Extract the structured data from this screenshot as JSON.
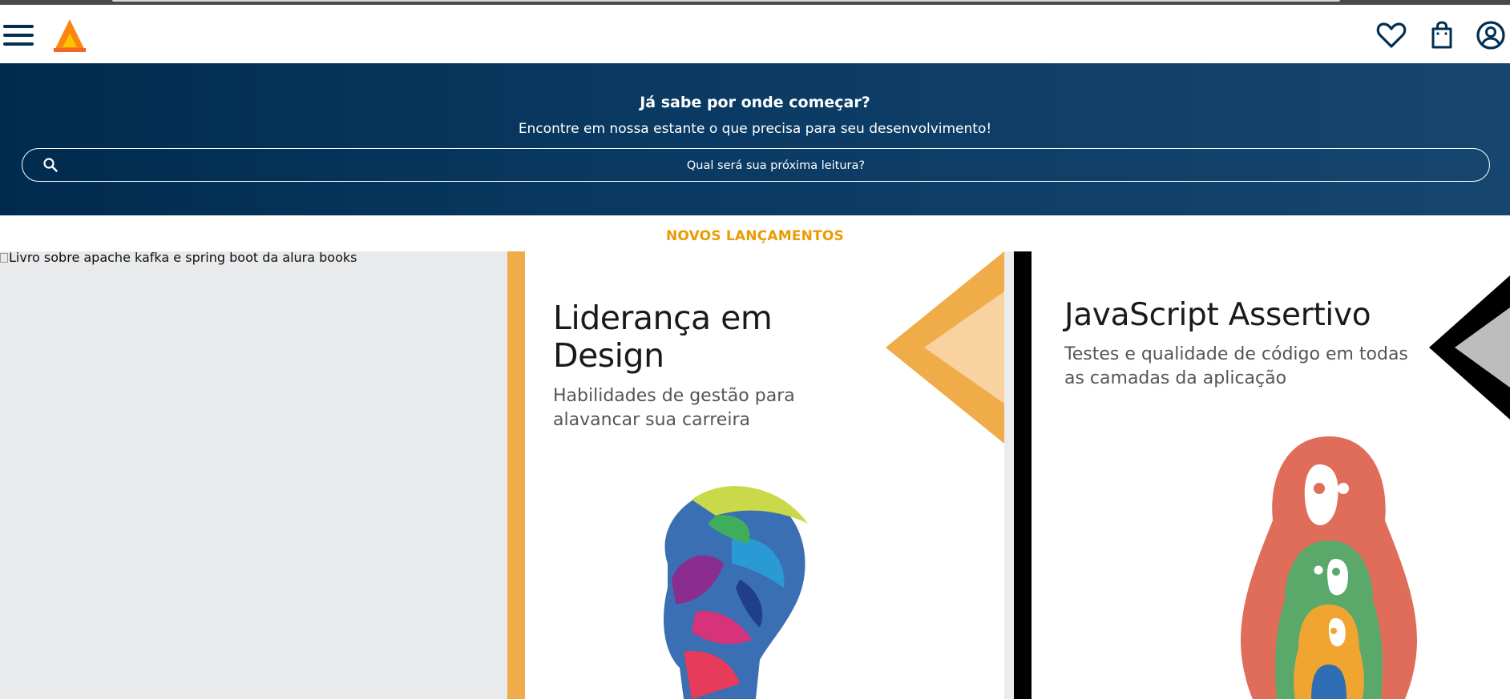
{
  "header": {
    "menu_icon": "hamburger-menu-icon",
    "logo_icon": "alurabooks-logo-icon",
    "icons": [
      "heart-icon",
      "shopping-bag-icon",
      "user-account-icon"
    ],
    "colors": {
      "brand_dark": "#002f52",
      "brand_orange": "#eb9b00"
    }
  },
  "banner": {
    "title": "Já sabe por onde começar?",
    "subtitle": "Encontre em nossa estante o que precisa para seu desenvolvimento!",
    "search_placeholder": "Qual será sua próxima leitura?",
    "search_icon": "search-icon"
  },
  "releases": {
    "title": "NOVOS LANÇAMENTOS",
    "broken_image_alt": "Livro sobre apache kafka e spring boot da alura books",
    "books": [
      {
        "title": "Liderança em Design",
        "subtitle": "Habilidades de gestão para alavancar sua carreira"
      },
      {
        "title": "JavaScript Assertivo",
        "subtitle": "Testes e qualidade de código em todas as camadas da aplicação"
      }
    ]
  }
}
